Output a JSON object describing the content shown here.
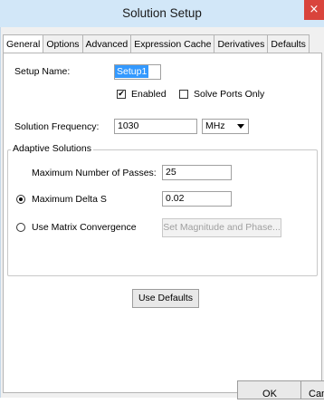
{
  "window": {
    "title": "Solution Setup",
    "close_label": "×"
  },
  "tabs": [
    {
      "label": "General",
      "active": true
    },
    {
      "label": "Options",
      "active": false
    },
    {
      "label": "Advanced",
      "active": false
    },
    {
      "label": "Expression Cache",
      "active": false
    },
    {
      "label": "Derivatives",
      "active": false
    },
    {
      "label": "Defaults",
      "active": false
    }
  ],
  "general": {
    "setup_name_label": "Setup Name:",
    "setup_name_value": "Setup1",
    "enabled_label": "Enabled",
    "enabled_checked": true,
    "enabled_mark": "✔",
    "solve_ports_label": "Solve Ports Only",
    "solve_ports_checked": false,
    "solution_frequency_label": "Solution Frequency:",
    "solution_frequency_value": "1030",
    "frequency_unit": "MHz"
  },
  "adaptive": {
    "group_title": "Adaptive Solutions",
    "max_passes_label": "Maximum Number of Passes:",
    "max_passes_value": "25",
    "max_delta_s_label": "Maximum Delta S",
    "max_delta_s_value": "0.02",
    "max_delta_s_selected": true,
    "matrix_convergence_label": "Use Matrix Convergence",
    "matrix_convergence_selected": false,
    "set_magnitude_button": "Set Magnitude and Phase..."
  },
  "buttons": {
    "use_defaults": "Use Defaults",
    "ok": "OK",
    "cancel": "Cancel"
  }
}
